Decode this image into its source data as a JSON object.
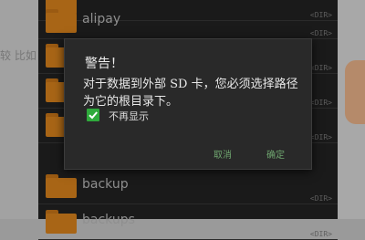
{
  "background": {
    "left_text": "较 比如",
    "files": [
      {
        "name": "",
        "tag": "<DIR>"
      },
      {
        "name": "alipay",
        "tag": "<DIR>"
      },
      {
        "name": "",
        "tag": "<DIR>"
      },
      {
        "name": "",
        "tag": "<DIR>"
      },
      {
        "name": "",
        "tag": "<DIR>"
      },
      {
        "name": "backup",
        "tag": "<DIR>"
      },
      {
        "name": "backups",
        "tag": "<DIR>"
      }
    ]
  },
  "dialog": {
    "title": "警告！",
    "message": "对于数据到外部 SD 卡，您必须选择路径为它的根目录下。",
    "checkbox_label": "不再显示",
    "checkbox_checked": true,
    "cancel_label": "取消",
    "ok_label": "确定"
  },
  "colors": {
    "accent_green": "#2faa3c",
    "button_text": "#6fa56f",
    "folder": "#a86516",
    "dialog_bg": "#292929"
  }
}
